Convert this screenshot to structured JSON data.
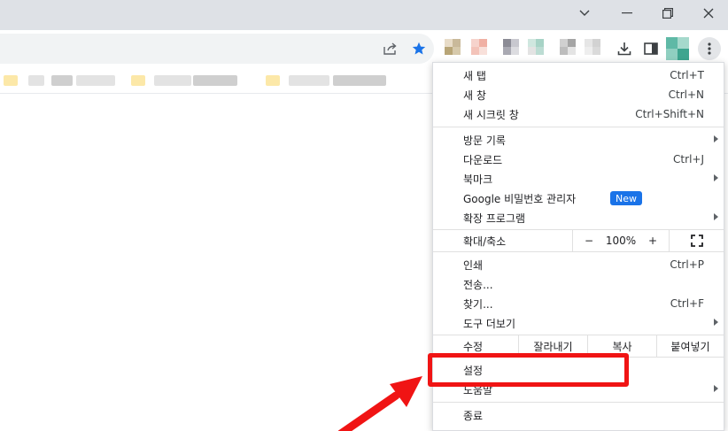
{
  "menu": {
    "new_tab": {
      "label": "새 탭",
      "shortcut": "Ctrl+T"
    },
    "new_window": {
      "label": "새 창",
      "shortcut": "Ctrl+N"
    },
    "incognito": {
      "label": "새 시크릿 창",
      "shortcut": "Ctrl+Shift+N"
    },
    "history": {
      "label": "방문 기록"
    },
    "downloads": {
      "label": "다운로드",
      "shortcut": "Ctrl+J"
    },
    "bookmarks": {
      "label": "북마크"
    },
    "password_manager": {
      "label": "Google 비밀번호 관리자",
      "badge": "New"
    },
    "extensions": {
      "label": "확장 프로그램"
    },
    "zoom": {
      "label": "확대/축소",
      "minus": "−",
      "value": "100%",
      "plus": "+"
    },
    "print": {
      "label": "인쇄",
      "shortcut": "Ctrl+P"
    },
    "cast": {
      "label": "전송..."
    },
    "find": {
      "label": "찾기...",
      "shortcut": "Ctrl+F"
    },
    "more_tools": {
      "label": "도구 더보기"
    },
    "edit": {
      "label": "수정",
      "cut": "잘라내기",
      "copy": "복사",
      "paste": "붙여넣기"
    },
    "settings": {
      "label": "설정"
    },
    "help": {
      "label": "도움말"
    },
    "exit": {
      "label": "종료"
    }
  },
  "colors": {
    "highlight": "#f01414",
    "badge": "#1a73e8",
    "star": "#1a73e8"
  }
}
